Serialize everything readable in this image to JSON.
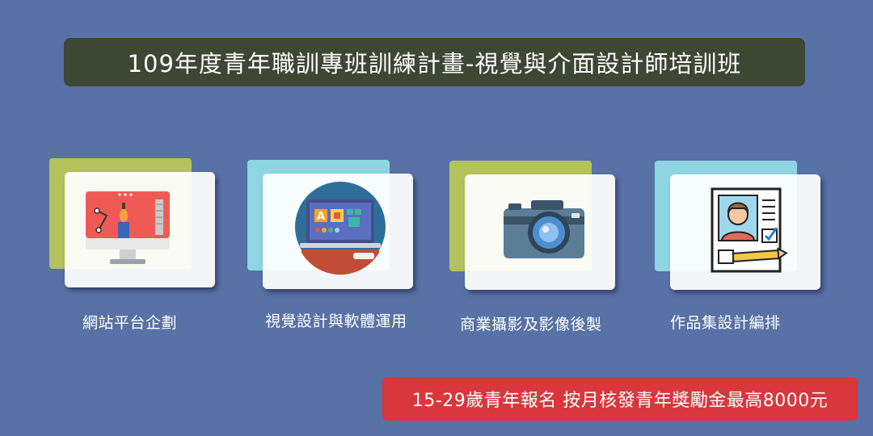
{
  "banner": {
    "title": "109年度青年職訓專班訓練計畫-視覺與介面設計師培訓班"
  },
  "courses": [
    {
      "label": "網站平台企劃",
      "icon": "web-design-monitor-icon",
      "accent": "#b4c25c"
    },
    {
      "label": "視覺設計與軟體運用",
      "icon": "design-software-laptop-icon",
      "accent": "#8fd6e3"
    },
    {
      "label": "商業攝影及影像後製",
      "icon": "camera-icon",
      "accent": "#b4c25c"
    },
    {
      "label": "作品集設計編排",
      "icon": "portfolio-profile-icon",
      "accent": "#8fd6e3"
    }
  ],
  "cta": {
    "text": "15-29歲青年報名 按月核發青年獎勵金最高8000元"
  },
  "colors": {
    "background": "#5871a6",
    "banner": "#3e4634",
    "cta": "#d9373c"
  }
}
